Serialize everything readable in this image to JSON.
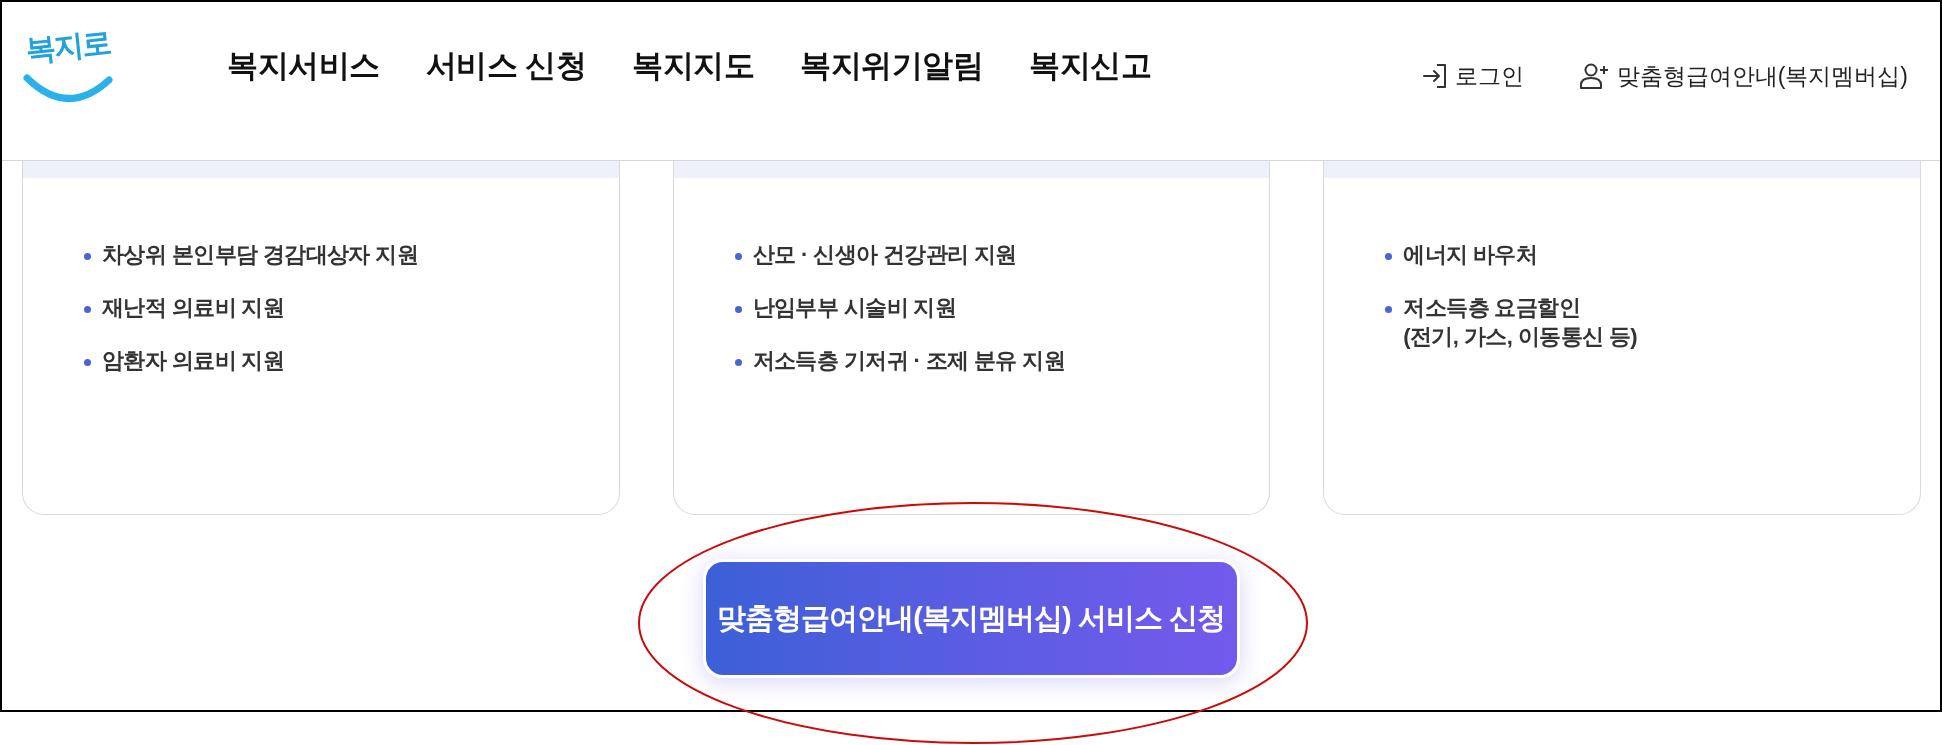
{
  "header": {
    "logo": "복지로",
    "nav": [
      "복지서비스",
      "서비스 신청",
      "복지지도",
      "복지위기알림",
      "복지신고"
    ],
    "utility_links": [
      {
        "kind": "login",
        "label": "로그인"
      },
      {
        "kind": "member",
        "label": "맞춤형급여안내(복지멤버십)"
      }
    ]
  },
  "cards": [
    {
      "items": [
        "차상위 본인부담 경감대상자 지원",
        "재난적 의료비 지원",
        "암환자 의료비 지원"
      ]
    },
    {
      "items": [
        "산모 · 신생아 건강관리 지원",
        "난임부부 시술비 지원",
        "저소득층 기저귀 · 조제 분유 지원"
      ]
    },
    {
      "items": [
        "에너지 바우처",
        "저소득층 요금할인\n(전기, 가스, 이동통신 등)"
      ]
    }
  ],
  "apply_button": {
    "label": "맞춤형급여안내(복지멤버십) 서비스 신청",
    "circled": true
  }
}
